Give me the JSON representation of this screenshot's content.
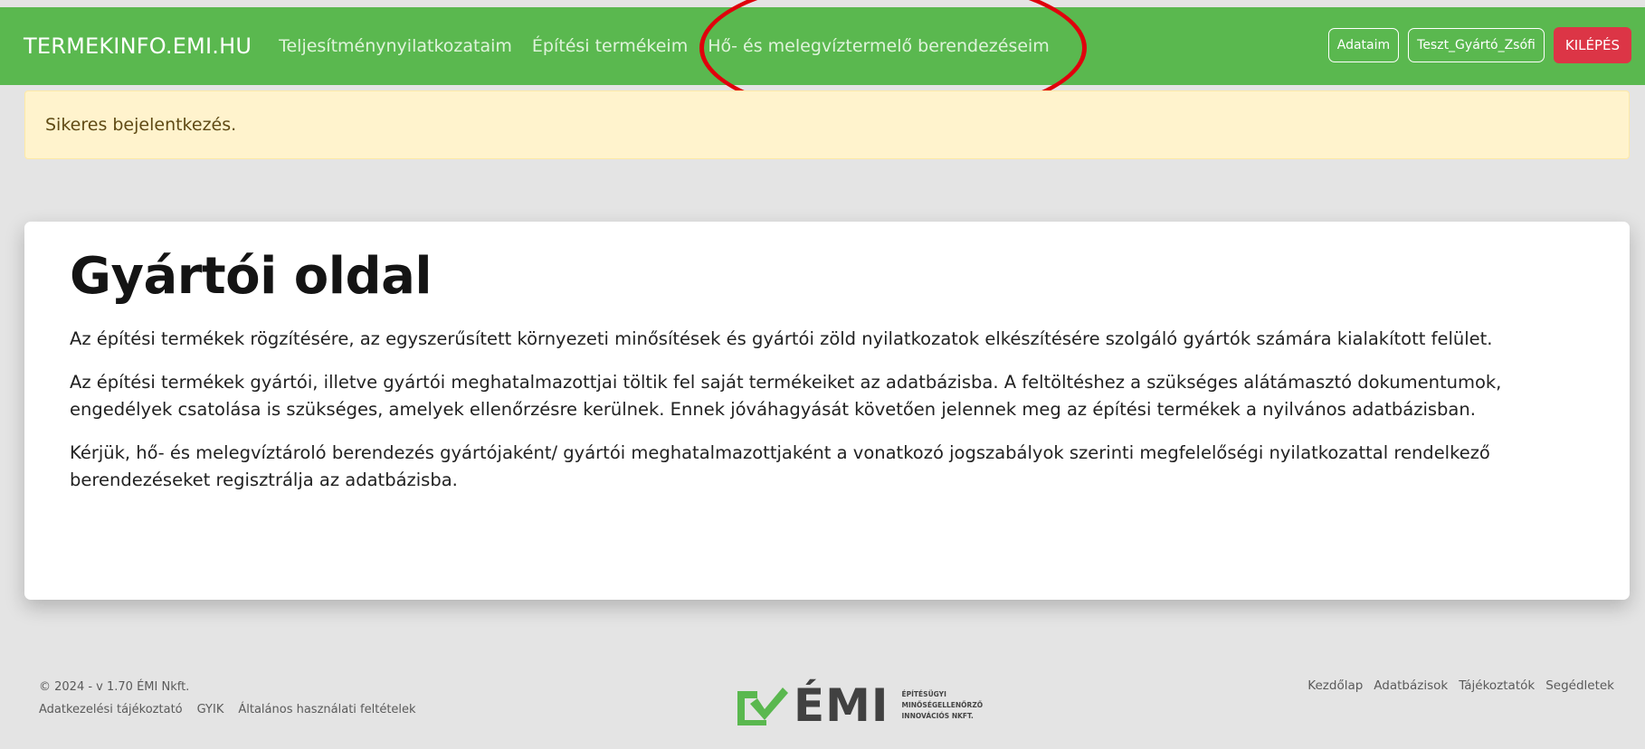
{
  "navbar": {
    "brand": "TERMEKINFO.EMI.HU",
    "links": [
      {
        "label": "Teljesítménynyilatkozataim"
      },
      {
        "label": "Építési termékeim"
      },
      {
        "label": "Hő- és melegvíztermelő berendezéseim"
      }
    ],
    "account_label": "Adataim",
    "user_label": "Teszt_Gyártó_Zsófi",
    "logout_label": "KILÉPÉS"
  },
  "alert": {
    "message": "Sikeres bejelentkezés."
  },
  "main": {
    "title": "Gyártói oldal",
    "paragraphs": [
      "Az építési termékek rögzítésére, az egyszerűsített környezeti minősítések és gyártói zöld nyilatkozatok elkészítésére szolgáló gyártók számára kialakított felület.",
      "Az építési termékek gyártói, illetve gyártói meghatalmazottjai töltik fel saját termékeiket az adatbázisba. A feltöltéshez a szükséges alátámasztó dokumentumok, engedélyek csatolása is szükséges, amelyek ellenőrzésre kerülnek. Ennek jóváhagyását követően jelennek meg az építési termékek a nyilvános adatbázisban.",
      "Kérjük, hő- és melegvíztároló berendezés gyártójaként/ gyártói meghatalmazottjaként a vonatkozó jogszabályok szerinti megfelelőségi nyilatkozattal rendelkező berendezéseket regisztrálja az adatbázisba."
    ]
  },
  "footer": {
    "copyright": "© 2024 - v 1.70 ÉMI Nkft.",
    "links_left": [
      "Adatkezelési tájékoztató",
      "GYIK",
      "Általános használati feltételek"
    ],
    "links_right": [
      "Kezdőlap",
      "Adatbázisok",
      "Tájékoztatók",
      "Segédletek"
    ],
    "logo": {
      "word": "ÉMI",
      "lines": [
        "ÉPÍTÉSÜGYI",
        "MINŐSÉGELLENŐRZŐ",
        "INNOVÁCIÓS NKFT."
      ]
    }
  },
  "colors": {
    "navbar_bg": "#5ab84f",
    "logout_bg": "#dc3546",
    "alert_bg": "#fff3cd",
    "annotation": "#e0000c",
    "logo_green": "#5ab84f",
    "logo_gray": "#414141"
  }
}
